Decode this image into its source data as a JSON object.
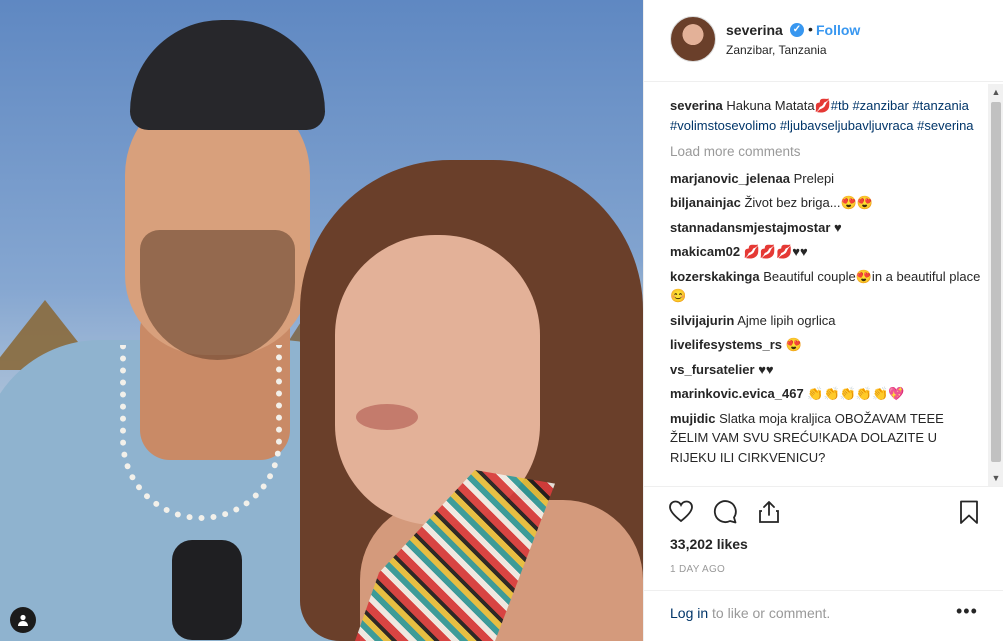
{
  "post": {
    "username": "severina",
    "follow_label": "Follow",
    "separator": "•",
    "location": "Zanzibar, Tanzania",
    "verified_glyph": "✓"
  },
  "caption": {
    "user": "severina",
    "text": "Hakuna Matata💋",
    "hashtags": [
      "#tb",
      "#zanzibar",
      "#tanzania",
      "#volimstosevolimo",
      "#ljubavseljubavljuvraca",
      "#severina"
    ]
  },
  "load_more": "Load more comments",
  "comments": [
    {
      "user": "marjanovic_jelenaa",
      "text": "Prelepi"
    },
    {
      "user": "biljanainjac",
      "text": "Život bez briga...😍😍"
    },
    {
      "user": "stannadansmjestajmostar",
      "text": "♥"
    },
    {
      "user": "makicam02",
      "text": "💋💋💋♥♥"
    },
    {
      "user": "kozerskakinga",
      "text": "Beautiful couple😍in a beautiful place😊"
    },
    {
      "user": "silvijajurin",
      "text": "Ajme lipih ogrlica"
    },
    {
      "user": "livelifesystems_rs",
      "text": "😍"
    },
    {
      "user": "vs_fursatelier",
      "text": "♥♥"
    },
    {
      "user": "marinkovic.evica_467",
      "text": "👏👏👏👏👏💖"
    },
    {
      "user": "mujidic",
      "text": "Slatka moja kraljica OBOŽAVAM TEEE ŽELIM VAM SVU SREĆU!KADA DOLAZITE U RIJEKU ILI CIRKVENICU?"
    }
  ],
  "likes": "33,202 likes",
  "time": "1 DAY AGO",
  "footer": {
    "login_link": "Log in",
    "login_rest": " to like or comment.",
    "more_glyph": "•••"
  },
  "icons": {
    "like": "heart-icon",
    "comment": "comment-bubble-icon",
    "share": "share-icon",
    "save": "bookmark-icon",
    "tag": "user-tag-icon"
  },
  "colors": {
    "link_blue": "#3897f0",
    "hashtag": "#003569",
    "muted": "#999999",
    "text": "#262626"
  }
}
